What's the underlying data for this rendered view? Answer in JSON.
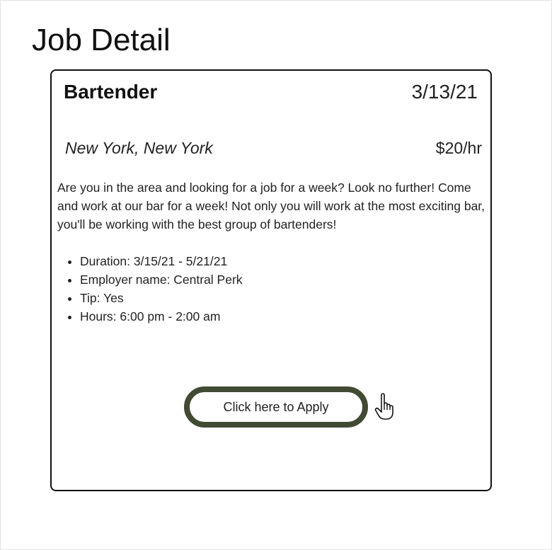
{
  "page": {
    "title": "Job Detail"
  },
  "job": {
    "title": "Bartender",
    "date": "3/13/21",
    "location": "New York, New York",
    "pay": "$20/hr",
    "description": "Are you in the area and looking for a job for a week? Look no further! Come and work at our bar for a week! Not only you will work at the most exciting bar,  you'll be working with the best group of bartenders!",
    "details": [
      "Duration: 3/15/21 - 5/21/21",
      "Employer name: Central Perk",
      "Tip: Yes",
      "Hours: 6:00 pm - 2:00 am"
    ]
  },
  "apply": {
    "label": "Click here to Apply",
    "cursor_icon": "pointer-hand-icon"
  },
  "colors": {
    "button_border": "#414a33",
    "card_border": "#111111"
  }
}
